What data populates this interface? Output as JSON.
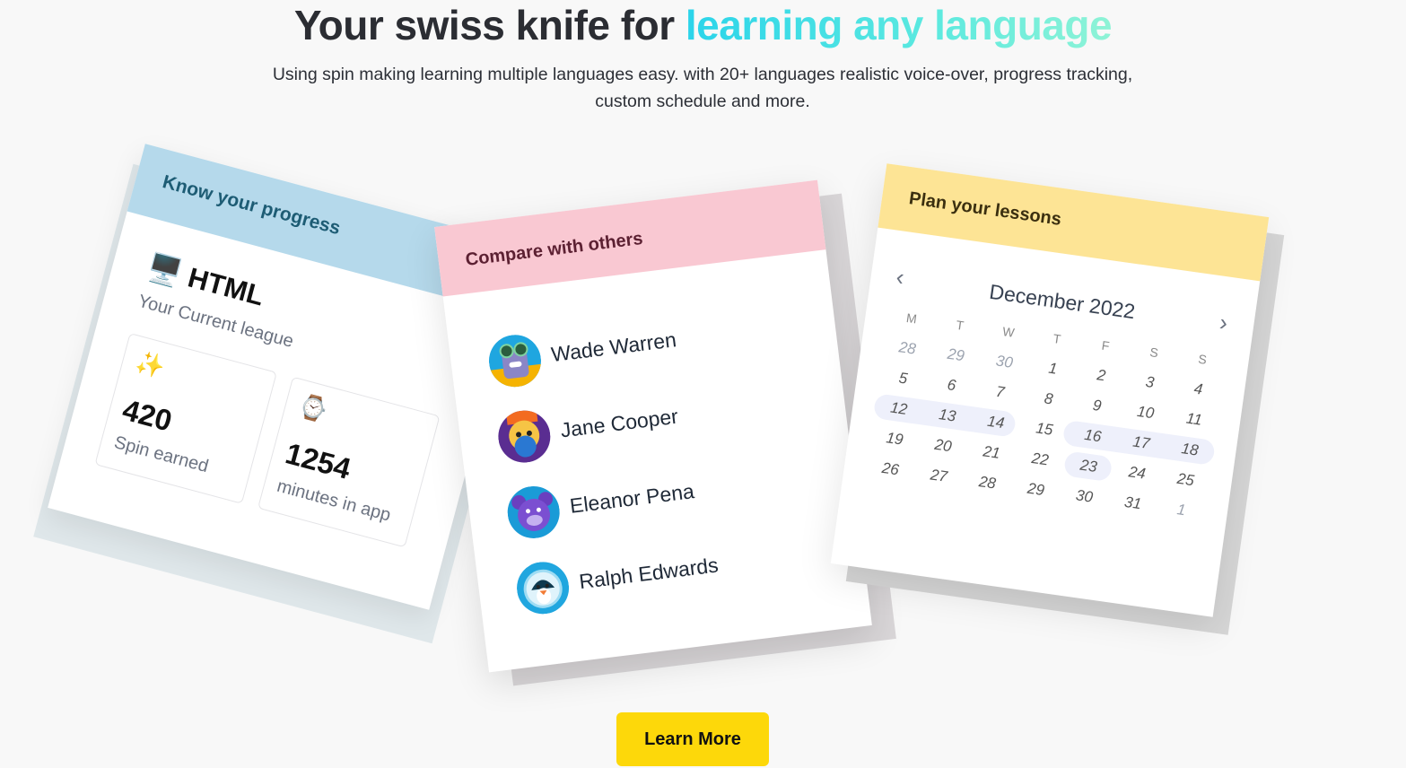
{
  "hero": {
    "title_plain": "Your swiss knife for ",
    "title_highlight": "learning any language",
    "subtitle_line1": "Using spin making learning multiple languages easy. with 20+ languages realistic voice-over, progress tracking,",
    "subtitle_line2": "custom schedule and more."
  },
  "progress_card": {
    "header": "Know your progress",
    "league_icon": "computer-icon",
    "league_glyph": "🖥️",
    "league": "HTML",
    "league_label": "Your Current league",
    "stats": [
      {
        "icon": "sparkles-icon",
        "glyph": "✨",
        "value": "420",
        "label": "Spin earned"
      },
      {
        "icon": "watch-icon",
        "glyph": "⌚",
        "value": "1254",
        "label": "minutes in app"
      }
    ]
  },
  "compare_card": {
    "header": "Compare with others",
    "people": [
      {
        "name": "Wade Warren",
        "avatar_color": "#1fa6e0"
      },
      {
        "name": "Jane Cooper",
        "avatar_color": "#5a2d91"
      },
      {
        "name": "Eleanor Pena",
        "avatar_color": "#1a9bd7"
      },
      {
        "name": "Ralph Edwards",
        "avatar_color": "#20a6df"
      }
    ]
  },
  "calendar_card": {
    "header": "Plan your lessons",
    "month": "December 2022",
    "prev_glyph": "‹",
    "next_glyph": "›",
    "weekdays": [
      "M",
      "T",
      "W",
      "T",
      "F",
      "S",
      "S"
    ],
    "weeks": [
      [
        "28",
        "29",
        "30",
        "1",
        "2",
        "3",
        "4"
      ],
      [
        "5",
        "6",
        "7",
        "8",
        "9",
        "10",
        "11"
      ],
      [
        "12",
        "13",
        "14",
        "15",
        "16",
        "17",
        "18"
      ],
      [
        "19",
        "20",
        "21",
        "22",
        "23",
        "24",
        "25"
      ],
      [
        "26",
        "27",
        "28",
        "29",
        "30",
        "31",
        "1"
      ]
    ]
  },
  "cta": {
    "label": "Learn More"
  },
  "colors": {
    "progress_band": "#b5d9eb",
    "compare_band": "#f9c8d2",
    "calendar_band": "#fde495",
    "cta": "#fdd80a",
    "title_gradient_start": "#2bd4ea"
  }
}
